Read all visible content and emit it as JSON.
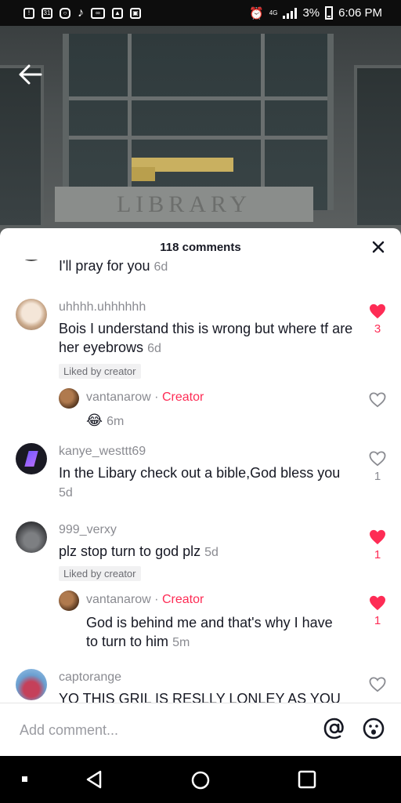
{
  "status_bar": {
    "left_icons": [
      "alert-icon",
      "calendar-icon",
      "instagram-icon",
      "tiktok-icon",
      "voicemail-icon",
      "gallery-icon",
      "screenshot-icon"
    ],
    "calendar_day": "31",
    "battery": "3%",
    "time": "6:06 PM"
  },
  "video": {
    "sign_text": "LIBRARY"
  },
  "comments_sheet": {
    "title": "118 comments",
    "partial_comment": {
      "text": "I'll pray for you",
      "time": "6d"
    },
    "comments": [
      {
        "username": "uhhhh.uhhhhhh",
        "text": "Bois I understand this is wrong but where tf are her eyebrows",
        "time": "6d",
        "badge": "Liked by creator",
        "likes": "3",
        "liked": true,
        "reply": {
          "username": "vantanarow",
          "creator_label": "Creator",
          "separator": "·",
          "emoji": "😂",
          "time": "6m"
        }
      },
      {
        "username": "kanye_westtt69",
        "text": "In the Libary check out a bible,God bless you",
        "time": "5d",
        "likes": "1",
        "liked": false
      },
      {
        "username": "999_verxy",
        "text": "plz stop turn to god plz",
        "time": "5d",
        "badge": "Liked by creator",
        "likes": "1",
        "liked": true,
        "reply": {
          "username": "vantanarow",
          "creator_label": "Creator",
          "separator": "·",
          "text": "God is behind me and that's why I have to turn to him",
          "time": "5m",
          "likes": "1",
          "liked": true
        }
      },
      {
        "username": "captorange",
        "text": "YO THIS GRIL IS RESLLY LONLEY AS YOU",
        "liked": false
      }
    ],
    "input_placeholder": "Add comment..."
  },
  "colors": {
    "accent": "#fe2c55",
    "text": "#161823",
    "muted": "#8a8b91"
  }
}
